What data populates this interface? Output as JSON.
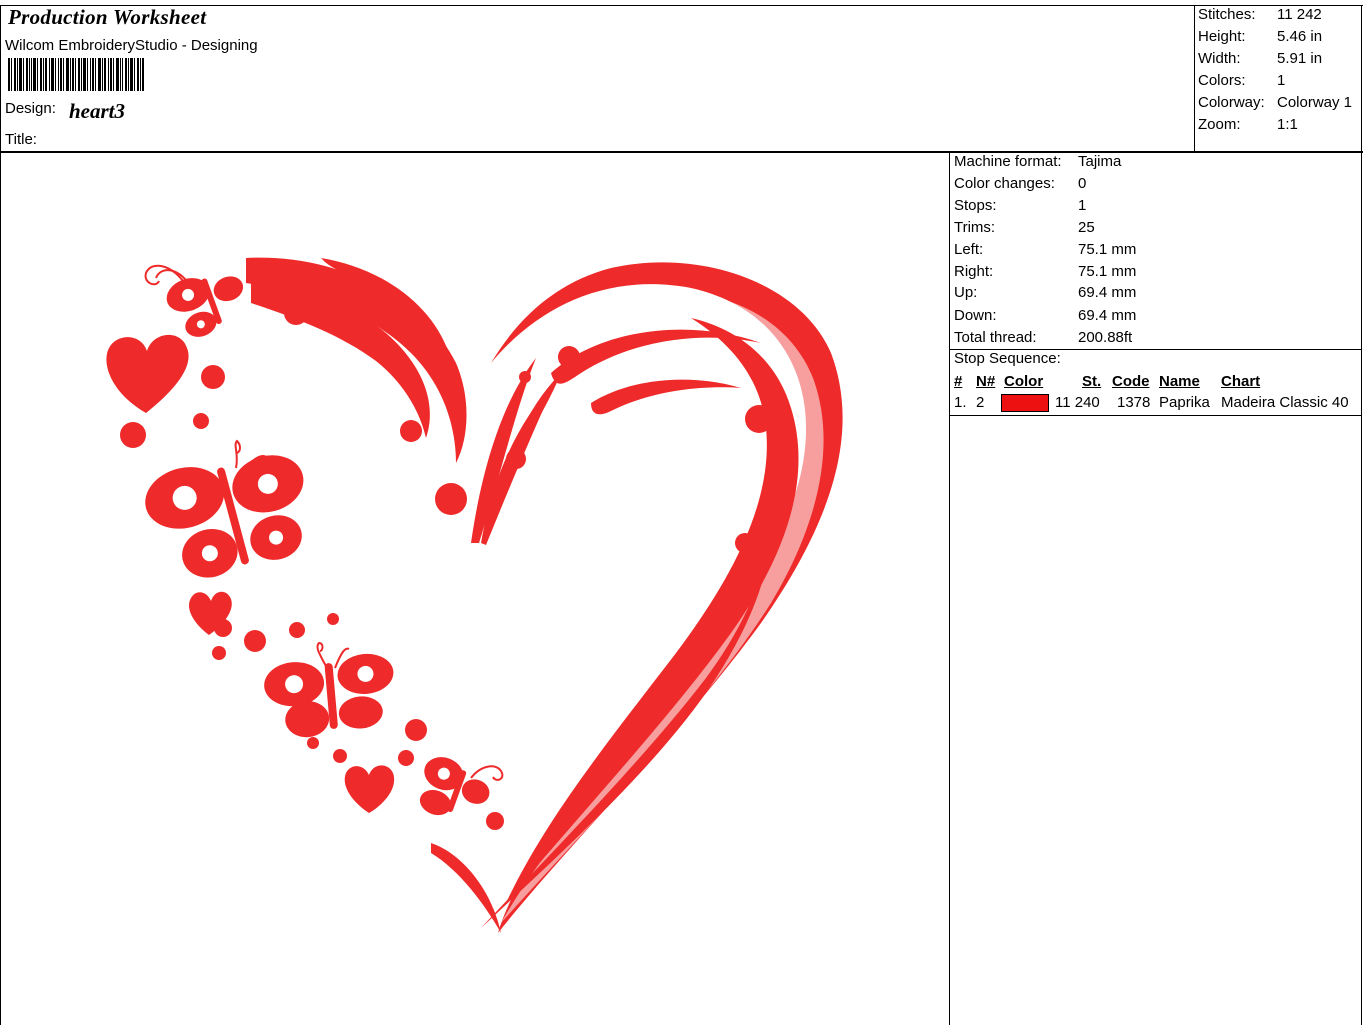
{
  "header": {
    "title": "Production Worksheet",
    "app_name": "Wilcom EmbroideryStudio - Designing",
    "design_label": "Design:",
    "design_value": "heart3",
    "title_label": "Title:"
  },
  "summary": [
    {
      "label": "Stitches:",
      "value": "11 242"
    },
    {
      "label": "Height:",
      "value": "5.46 in"
    },
    {
      "label": "Width:",
      "value": "5.91 in"
    },
    {
      "label": "Colors:",
      "value": "1"
    },
    {
      "label": "Colorway:",
      "value": "Colorway 1"
    },
    {
      "label": "Zoom:",
      "value": "1:1"
    }
  ],
  "machine_info": [
    {
      "label": "Machine format:",
      "value": "Tajima"
    },
    {
      "label": "Color changes:",
      "value": "0"
    },
    {
      "label": "Stops:",
      "value": "1"
    },
    {
      "label": "Trims:",
      "value": "25"
    },
    {
      "label": "Left:",
      "value": "75.1 mm"
    },
    {
      "label": "Right:",
      "value": "75.1 mm"
    },
    {
      "label": "Up:",
      "value": "69.4 mm"
    },
    {
      "label": "Down:",
      "value": "69.4 mm"
    },
    {
      "label": "Total thread:",
      "value": "200.88ft"
    }
  ],
  "stop_sequence": {
    "title": "Stop Sequence:",
    "headers": {
      "num": "#",
      "n": "N#",
      "color": "Color",
      "st": "St.",
      "code": "Code",
      "name": "Name",
      "chart": "Chart"
    },
    "rows": [
      {
        "num": "1.",
        "n": "2",
        "color_hex": "#ee1111",
        "st": "11 240",
        "code": "1378",
        "name": "Paprika",
        "chart": "Madeira Classic 40"
      }
    ]
  },
  "colors": {
    "thread": "#ee2a2a",
    "swatch": "#ee1111"
  }
}
